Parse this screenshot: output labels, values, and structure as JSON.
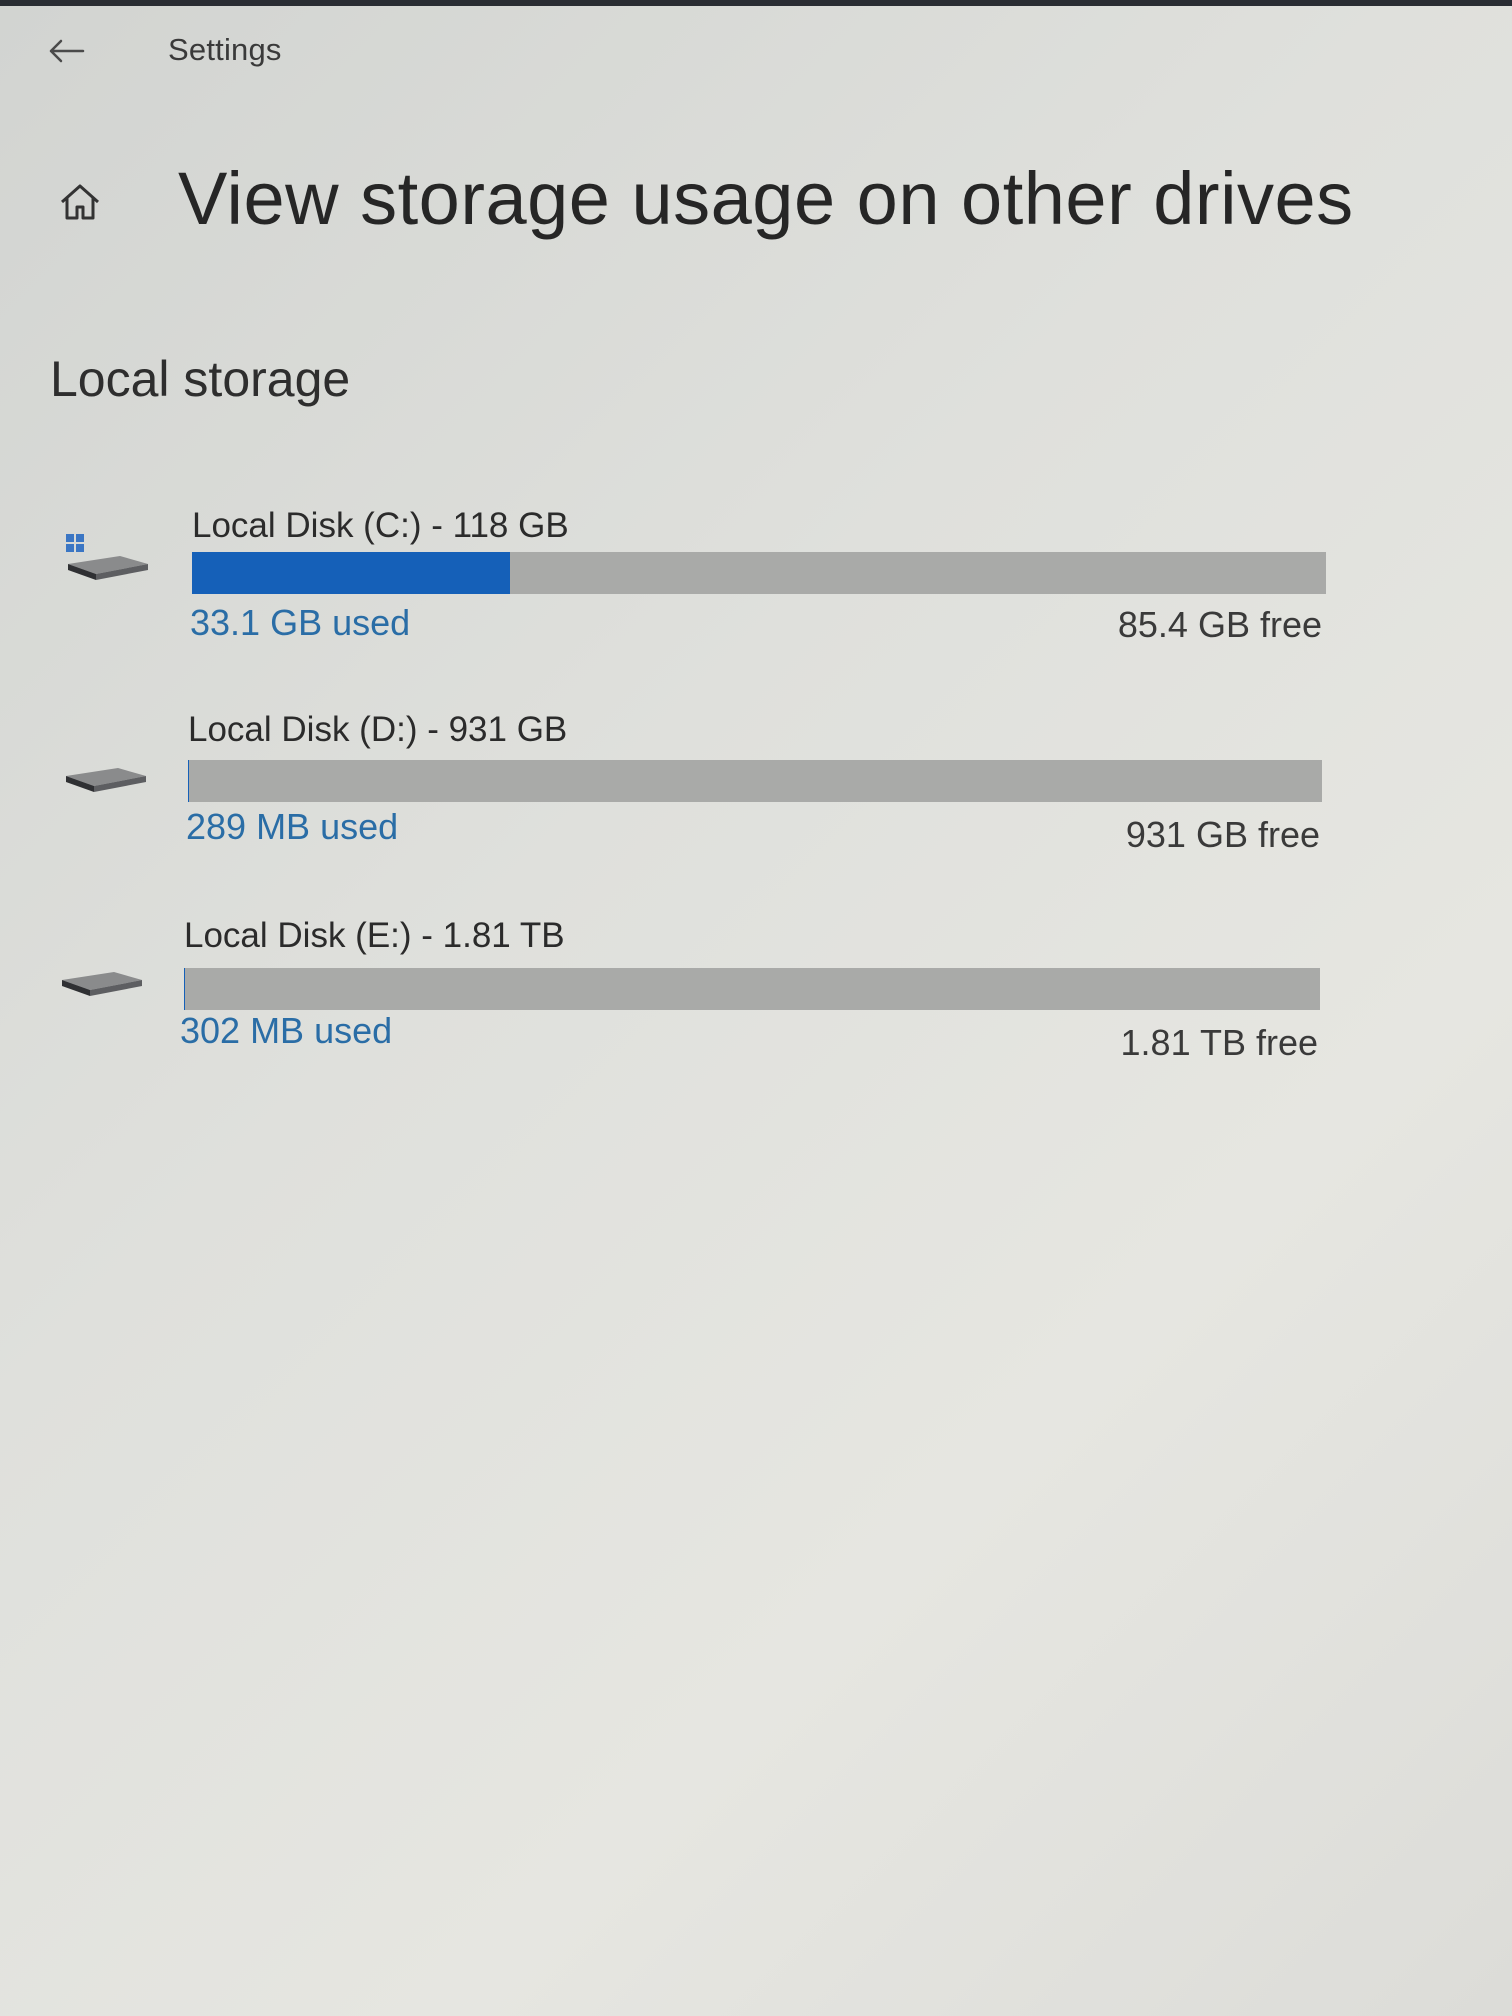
{
  "window": {
    "app_title": "Settings"
  },
  "header": {
    "back_icon": "back-arrow-icon",
    "home_icon": "home-icon",
    "page_title": "View storage usage on other drives"
  },
  "section": {
    "title": "Local storage"
  },
  "colors": {
    "accent": "#1560b8",
    "used_text": "#2a6da6",
    "bar_track": "#a9aaa8"
  },
  "drives": [
    {
      "name": "Local Disk (C:) - 118 GB",
      "used": "33.1 GB used",
      "free": "85.4 GB free",
      "used_fraction": 0.28,
      "icon": "system-drive-icon"
    },
    {
      "name": "Local Disk (D:) - 931 GB",
      "used": "289 MB used",
      "free": "931 GB free",
      "used_fraction": 0.0003,
      "icon": "drive-icon"
    },
    {
      "name": "Local Disk (E:) - 1.81 TB",
      "used": "302 MB used",
      "free": "1.81 TB free",
      "used_fraction": 0.0002,
      "icon": "drive-icon"
    }
  ]
}
